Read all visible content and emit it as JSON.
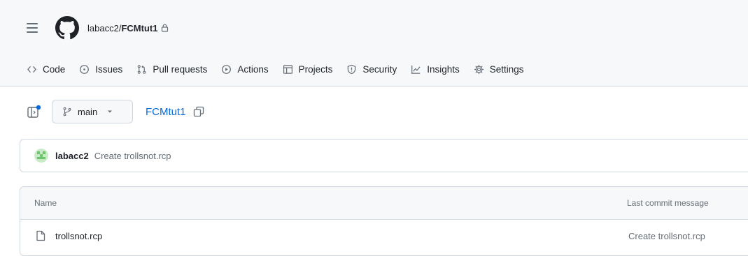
{
  "header": {
    "owner": "labacc2",
    "separator": "/",
    "repo_name": "FCMtut1"
  },
  "tabs": [
    {
      "label": "Code",
      "icon": "code-icon"
    },
    {
      "label": "Issues",
      "icon": "issue-opened-icon"
    },
    {
      "label": "Pull requests",
      "icon": "git-pull-request-icon"
    },
    {
      "label": "Actions",
      "icon": "play-icon"
    },
    {
      "label": "Projects",
      "icon": "table-icon"
    },
    {
      "label": "Security",
      "icon": "shield-icon"
    },
    {
      "label": "Insights",
      "icon": "graph-icon"
    },
    {
      "label": "Settings",
      "icon": "gear-icon"
    }
  ],
  "toolbar": {
    "branch": "main",
    "repo_link": "FCMtut1"
  },
  "latest_commit": {
    "author": "labacc2",
    "message": "Create trollsnot.rcp"
  },
  "files": {
    "col_name": "Name",
    "col_message": "Last commit message",
    "rows": [
      {
        "name": "trollsnot.rcp",
        "message": "Create trollsnot.rcp"
      }
    ]
  },
  "colors": {
    "accent": "#0969da",
    "header_bg": "#f6f8fa",
    "border": "#d0d7de",
    "muted_text": "#656d76"
  }
}
